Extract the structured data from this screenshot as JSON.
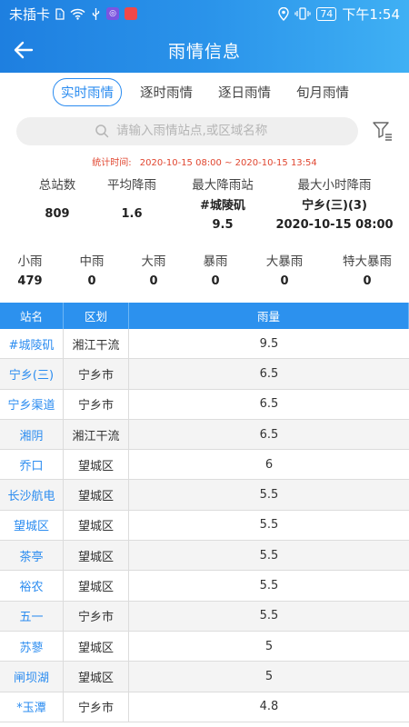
{
  "status_bar": {
    "carrier": "未插卡",
    "battery": "74",
    "time": "下午1:54"
  },
  "header": {
    "title": "雨情信息"
  },
  "tabs": [
    {
      "label": "实时雨情",
      "active": true
    },
    {
      "label": "逐时雨情",
      "active": false
    },
    {
      "label": "逐日雨情",
      "active": false
    },
    {
      "label": "旬月雨情",
      "active": false
    }
  ],
  "search": {
    "placeholder": "请输入雨情站点,或区域名称"
  },
  "stat_time": {
    "label": "统计时间:",
    "range": "2020-10-15 08:00 ~ 2020-10-15 13:54"
  },
  "summary": {
    "total_stations": {
      "label": "总站数",
      "value": "809"
    },
    "avg_rain": {
      "label": "平均降雨",
      "value": "1.6"
    },
    "max_station": {
      "label": "最大降雨站",
      "name": "#城陵矶",
      "value": "9.5"
    },
    "max_hourly": {
      "label": "最大小时降雨",
      "name": "宁乡(三)(3)",
      "time": "2020-10-15 08:00"
    }
  },
  "levels": [
    {
      "label": "小雨",
      "value": "479"
    },
    {
      "label": "中雨",
      "value": "0"
    },
    {
      "label": "大雨",
      "value": "0"
    },
    {
      "label": "暴雨",
      "value": "0"
    },
    {
      "label": "大暴雨",
      "value": "0"
    },
    {
      "label": "特大暴雨",
      "value": "0"
    }
  ],
  "table": {
    "headers": [
      "站名",
      "区划",
      "雨量"
    ],
    "rows": [
      [
        "#城陵矶",
        "湘江干流",
        "9.5"
      ],
      [
        "宁乡(三)",
        "宁乡市",
        "6.5"
      ],
      [
        "宁乡渠道",
        "宁乡市",
        "6.5"
      ],
      [
        "湘阴",
        "湘江干流",
        "6.5"
      ],
      [
        "乔口",
        "望城区",
        "6"
      ],
      [
        "长沙航电",
        "望城区",
        "5.5"
      ],
      [
        "望城区",
        "望城区",
        "5.5"
      ],
      [
        "茶亭",
        "望城区",
        "5.5"
      ],
      [
        "裕农",
        "望城区",
        "5.5"
      ],
      [
        "五一",
        "宁乡市",
        "5.5"
      ],
      [
        "苏蓼",
        "望城区",
        "5"
      ],
      [
        "闸坝湖",
        "望城区",
        "5"
      ],
      [
        "*玉潭",
        "宁乡市",
        "4.8"
      ]
    ]
  },
  "colors": {
    "primary": "#2b8cf0",
    "header_start": "#1e7fe0",
    "header_end": "#3fb0f4",
    "stat_time": "#e0452f"
  }
}
